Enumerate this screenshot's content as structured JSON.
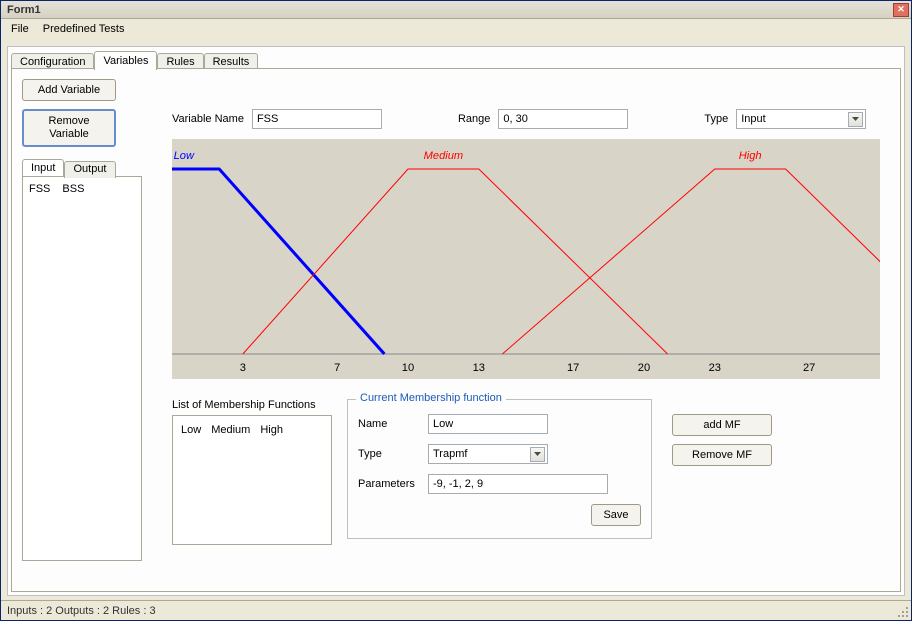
{
  "window": {
    "title": "Form1"
  },
  "menu": {
    "file": "File",
    "predef": "Predefined Tests"
  },
  "tabs": {
    "configuration": "Configuration",
    "variables": "Variables",
    "rules": "Rules",
    "results": "Results"
  },
  "subtabs": {
    "input": "Input",
    "output": "Output",
    "items": [
      "FSS",
      "BSS"
    ]
  },
  "buttons": {
    "add_variable": "Add Variable",
    "remove_variable": "Remove\nVariable",
    "add_mf": "add MF",
    "remove_mf": "Remove MF",
    "save": "Save"
  },
  "labels": {
    "variable_name": "Variable Name",
    "range": "Range",
    "type": "Type",
    "mf_list": "List of Membership Functions",
    "mf_name": "Name",
    "mf_type": "Type",
    "mf_params": "Parameters",
    "mf_group": "Current Membership function"
  },
  "values": {
    "variable_name": "FSS",
    "range": "0, 30",
    "type": "Input",
    "mf_name": "Low",
    "mf_type": "Trapmf",
    "mf_params": "-9, -1, 2, 9"
  },
  "mf_list_items": [
    "Low",
    "Medium",
    "High"
  ],
  "status": "Inputs : 2  Outputs : 2  Rules : 3",
  "chart_data": {
    "type": "line",
    "title": "",
    "xlabel": "",
    "ylabel": "",
    "xlim": [
      0,
      30
    ],
    "ylim": [
      0,
      1
    ],
    "x_ticks": [
      3,
      7,
      10,
      13,
      17,
      20,
      23,
      27
    ],
    "series": [
      {
        "name": "Low",
        "selected": true,
        "color": "#0000ff",
        "points": [
          [
            -9,
            0
          ],
          [
            -1,
            1
          ],
          [
            2,
            1
          ],
          [
            9,
            0
          ]
        ]
      },
      {
        "name": "Medium",
        "selected": false,
        "color": "#ff0000",
        "points": [
          [
            3,
            0
          ],
          [
            10,
            1
          ],
          [
            13,
            1
          ],
          [
            21,
            0
          ]
        ]
      },
      {
        "name": "High",
        "selected": false,
        "color": "#ff0000",
        "points": [
          [
            14,
            0
          ],
          [
            23,
            1
          ],
          [
            26,
            1
          ],
          [
            34,
            0
          ]
        ]
      }
    ]
  }
}
